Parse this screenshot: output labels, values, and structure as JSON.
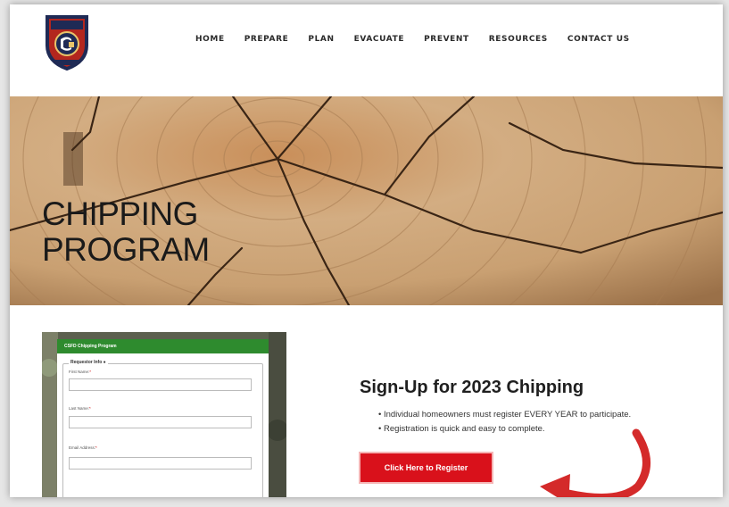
{
  "header": {
    "nav": [
      "HOME",
      "PREPARE",
      "PLAN",
      "EVACUATE",
      "PREVENT",
      "RESOURCES",
      "CONTACT US"
    ]
  },
  "hero": {
    "title_line1": "CHIPPING",
    "title_line2": "PROGRAM"
  },
  "form_preview": {
    "header": "CSFD Chipping Program",
    "legend": "Requestor Info",
    "fields": [
      "First Name:",
      "Last Name:",
      "Email Address:"
    ]
  },
  "signup": {
    "title": "Sign-Up for 2023 Chipping",
    "bullets": [
      "• Individual homeowners must register EVERY YEAR to participate.",
      "• Registration is quick and easy to complete."
    ],
    "button_label": "Click Here to Register"
  },
  "colors": {
    "accent_red": "#d9111b",
    "form_green": "#2e8b2e",
    "wood": "#c9a072"
  },
  "icons": {
    "logo": "fire-department-badge-icon",
    "arrow": "curved-red-arrow-icon"
  }
}
